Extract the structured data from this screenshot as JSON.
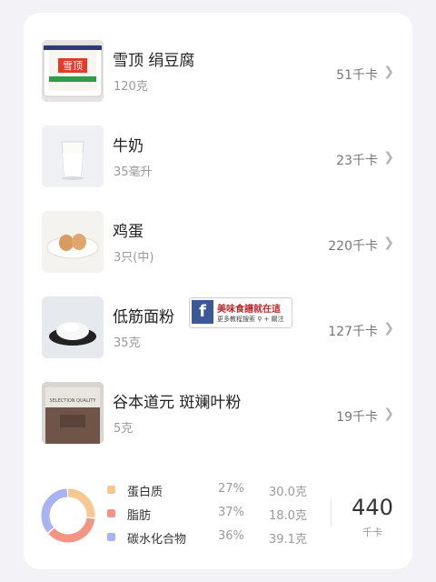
{
  "foods": [
    {
      "name": "雪顶 绢豆腐",
      "amount": "120克",
      "kcal": "51千卡"
    },
    {
      "name": "牛奶",
      "amount": "35毫升",
      "kcal": "23千卡"
    },
    {
      "name": "鸡蛋",
      "amount": "3只(中)",
      "kcal": "220千卡"
    },
    {
      "name": "低筋面粉",
      "amount": "35克",
      "kcal": "127千卡"
    },
    {
      "name": "谷本道元 斑斓叶粉",
      "amount": "5克",
      "kcal": "19千卡"
    }
  ],
  "packages": {
    "tofu": "雪顶",
    "powder": "SELECTION QUALITY"
  },
  "badge": {
    "logo": "f",
    "title": "美味食譜就在這",
    "subtitle": "更多教程搜索 ⚲ + 關注"
  },
  "macros": [
    {
      "label": "蛋白质",
      "percent": "27%",
      "grams": "30.0克",
      "color": "#f7c891"
    },
    {
      "label": "脂肪",
      "percent": "37%",
      "grams": "18.0克",
      "color": "#f39585"
    },
    {
      "label": "碳水化合物",
      "percent": "36%",
      "grams": "39.1克",
      "color": "#a9b3f2"
    }
  ],
  "total": {
    "value": "440",
    "unit": "千卡"
  },
  "icons": {
    "chevron": "chevron-right-icon"
  }
}
